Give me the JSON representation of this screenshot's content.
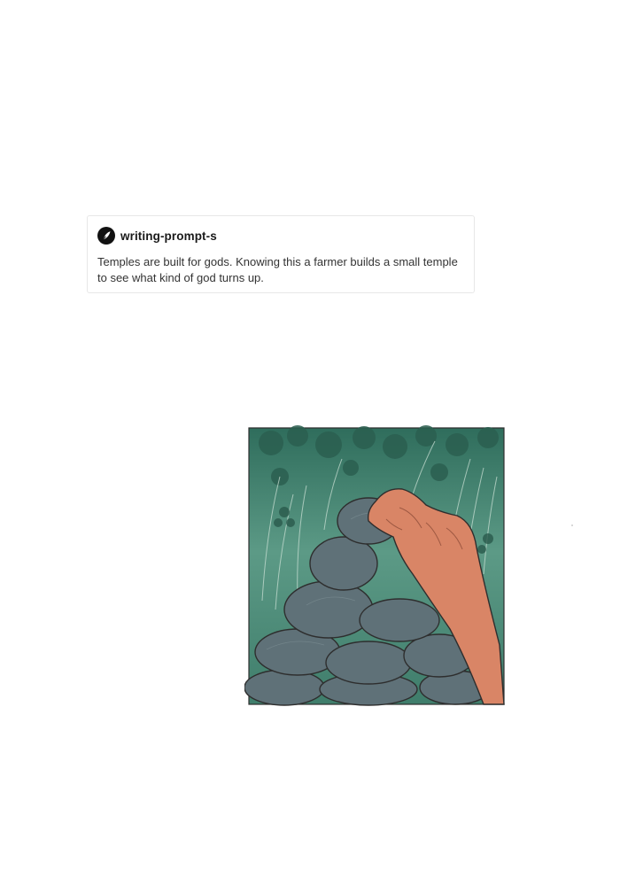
{
  "post": {
    "username": "writing-prompt-s",
    "avatar_icon": "quill-pen-icon",
    "text": "Temples are built for gods. Knowing this a farmer builds a small temple to see what kind of god turns up."
  },
  "illustration": {
    "subject": "hand-stacking-stones-icon",
    "colors": {
      "foliage": "#3f7d6b",
      "stone": "#5f7178",
      "hand": "#d98566",
      "outline": "#2e2e2e"
    }
  }
}
